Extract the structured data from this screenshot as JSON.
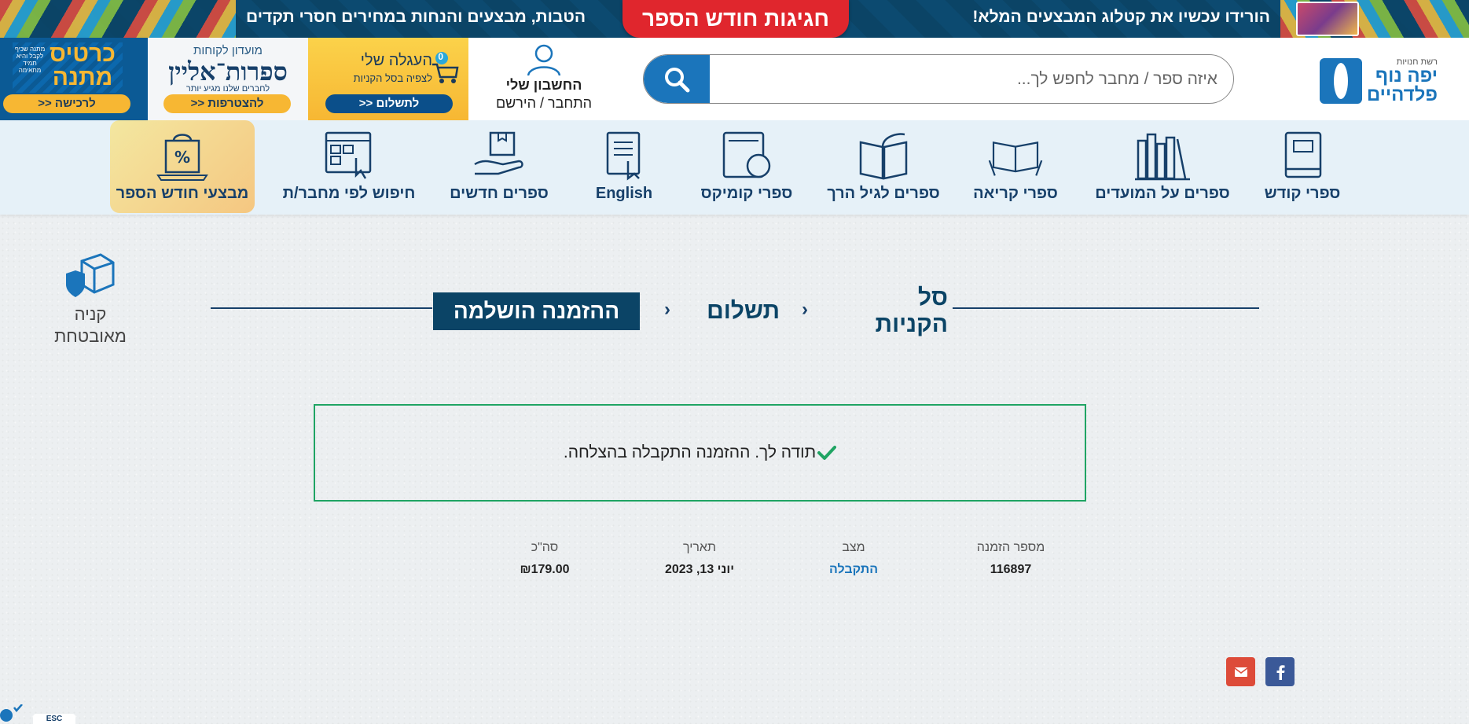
{
  "promo": {
    "right_text": "הורידו עכשיו את קטלוג המבצעים המלא!",
    "badge": "חגיגות חודש הספר",
    "left_text": "הטבות, מבצעים והנחות במחירים חסרי תקדים"
  },
  "header": {
    "logo_small": "רשת חנויות",
    "logo_line1": "יפה נוף",
    "logo_line2": "פלדהיים",
    "search_placeholder": "איזה ספר / מחבר לחפש לך...",
    "account_label": "החשבון שלי",
    "account_sub": "התחבר / הירשם",
    "cart_title": "העגלה שלי",
    "cart_sub": "לצפיה בסל הקניות",
    "cart_count": "0",
    "cart_button": "לתשלום <<",
    "club_small": "מועדון לקוחות",
    "club_brand": "ספרות־אליין",
    "club_tag": "לחברים שלנו מגיע יותר",
    "club_button": "להצטרפות <<",
    "gift_big": "כרטיס מתנה",
    "gift_tiny": "מתנה שכיף לקבל והיא תמיד מתאימה",
    "gift_button": "לרכישה <<"
  },
  "nav": {
    "items": [
      {
        "label": "ספרי קודש",
        "icon": "book-icon"
      },
      {
        "label": "ספרים על המועדים",
        "icon": "bookshelf-icon"
      },
      {
        "label": "ספרי קריאה",
        "icon": "reader-icon"
      },
      {
        "label": "ספרים לגיל הרך",
        "icon": "open-book-icon"
      },
      {
        "label": "ספרי קומיקס",
        "icon": "comic-icon"
      },
      {
        "label": "English",
        "icon": "document-icon"
      },
      {
        "label": "ספרים חדשים",
        "icon": "new-box-icon"
      },
      {
        "label": "חיפוש לפי מחבר/ת",
        "icon": "search-author-icon"
      },
      {
        "label": "מבצעי חודש הספר",
        "icon": "discount-bag-icon"
      }
    ]
  },
  "secure": {
    "line1": "קניה",
    "line2": "מאובטחת"
  },
  "steps": {
    "cart": "סל הקניות",
    "payment": "תשלום",
    "complete": "ההזמנה הושלמה"
  },
  "success_message": "תודה לך. ההזמנה התקבלה בהצלחה.",
  "order": {
    "number_label": "מספר הזמנה",
    "number_value": "116897",
    "status_label": "מצב",
    "status_value": "התקבלה",
    "date_label": "תאריך",
    "date_value": "יוני 13, 2023",
    "total_label": "סה\"כ",
    "total_value": "₪179.00"
  },
  "accessibility": {
    "esc": "ESC"
  },
  "colors": {
    "brand_blue": "#1b75bb",
    "navy": "#0b4466",
    "success_green": "#1fa463",
    "promo_red": "#e0262d",
    "gold": "#f7b733"
  }
}
